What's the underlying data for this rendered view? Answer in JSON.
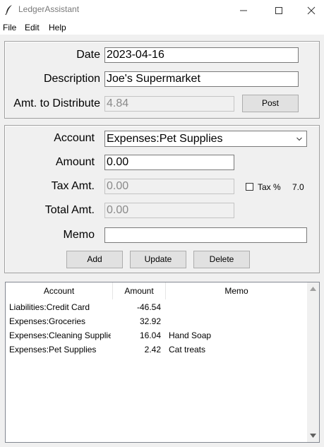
{
  "window": {
    "title": "LedgerAssistant",
    "icon": "feather-icon",
    "controls": [
      "minimize-icon",
      "maximize-icon",
      "close-icon"
    ]
  },
  "menu": {
    "file": "File",
    "edit": "Edit",
    "help": "Help"
  },
  "transaction": {
    "date_label": "Date",
    "date_value": "2023-04-16",
    "description_label": "Description",
    "description_value": "Joe's Supermarket",
    "amt_to_distribute_label": "Amt. to Distribute",
    "amt_to_distribute_value": "4.84",
    "post_button": "Post"
  },
  "split": {
    "account_label": "Account",
    "account_value": "Expenses:Pet Supplies",
    "amount_label": "Amount",
    "amount_value": "0.00",
    "tax_amt_label": "Tax Amt.",
    "tax_amt_value": "0.00",
    "tax_checkbox_label": "Tax %",
    "tax_checked": false,
    "tax_rate": "7.0",
    "total_amt_label": "Total Amt.",
    "total_amt_value": "0.00",
    "memo_label": "Memo",
    "memo_value": "",
    "add_button": "Add",
    "update_button": "Update",
    "delete_button": "Delete"
  },
  "splits_table": {
    "columns": [
      "Account",
      "Amount",
      "Memo"
    ],
    "rows": [
      {
        "account": "Liabilities:Credit Card",
        "amount": "-46.54",
        "memo": ""
      },
      {
        "account": "Expenses:Groceries",
        "amount": "32.92",
        "memo": ""
      },
      {
        "account": "Expenses:Cleaning Supplies",
        "amount": "16.04",
        "memo": "Hand Soap"
      },
      {
        "account": "Expenses:Pet Supplies",
        "amount": "2.42",
        "memo": "Cat treats"
      }
    ]
  },
  "colors": {
    "window_bg": "#f0f0f0",
    "entry_bg": "#ffffff",
    "button_bg": "#e1e1e1",
    "disabled_text": "#8a8a8a"
  }
}
